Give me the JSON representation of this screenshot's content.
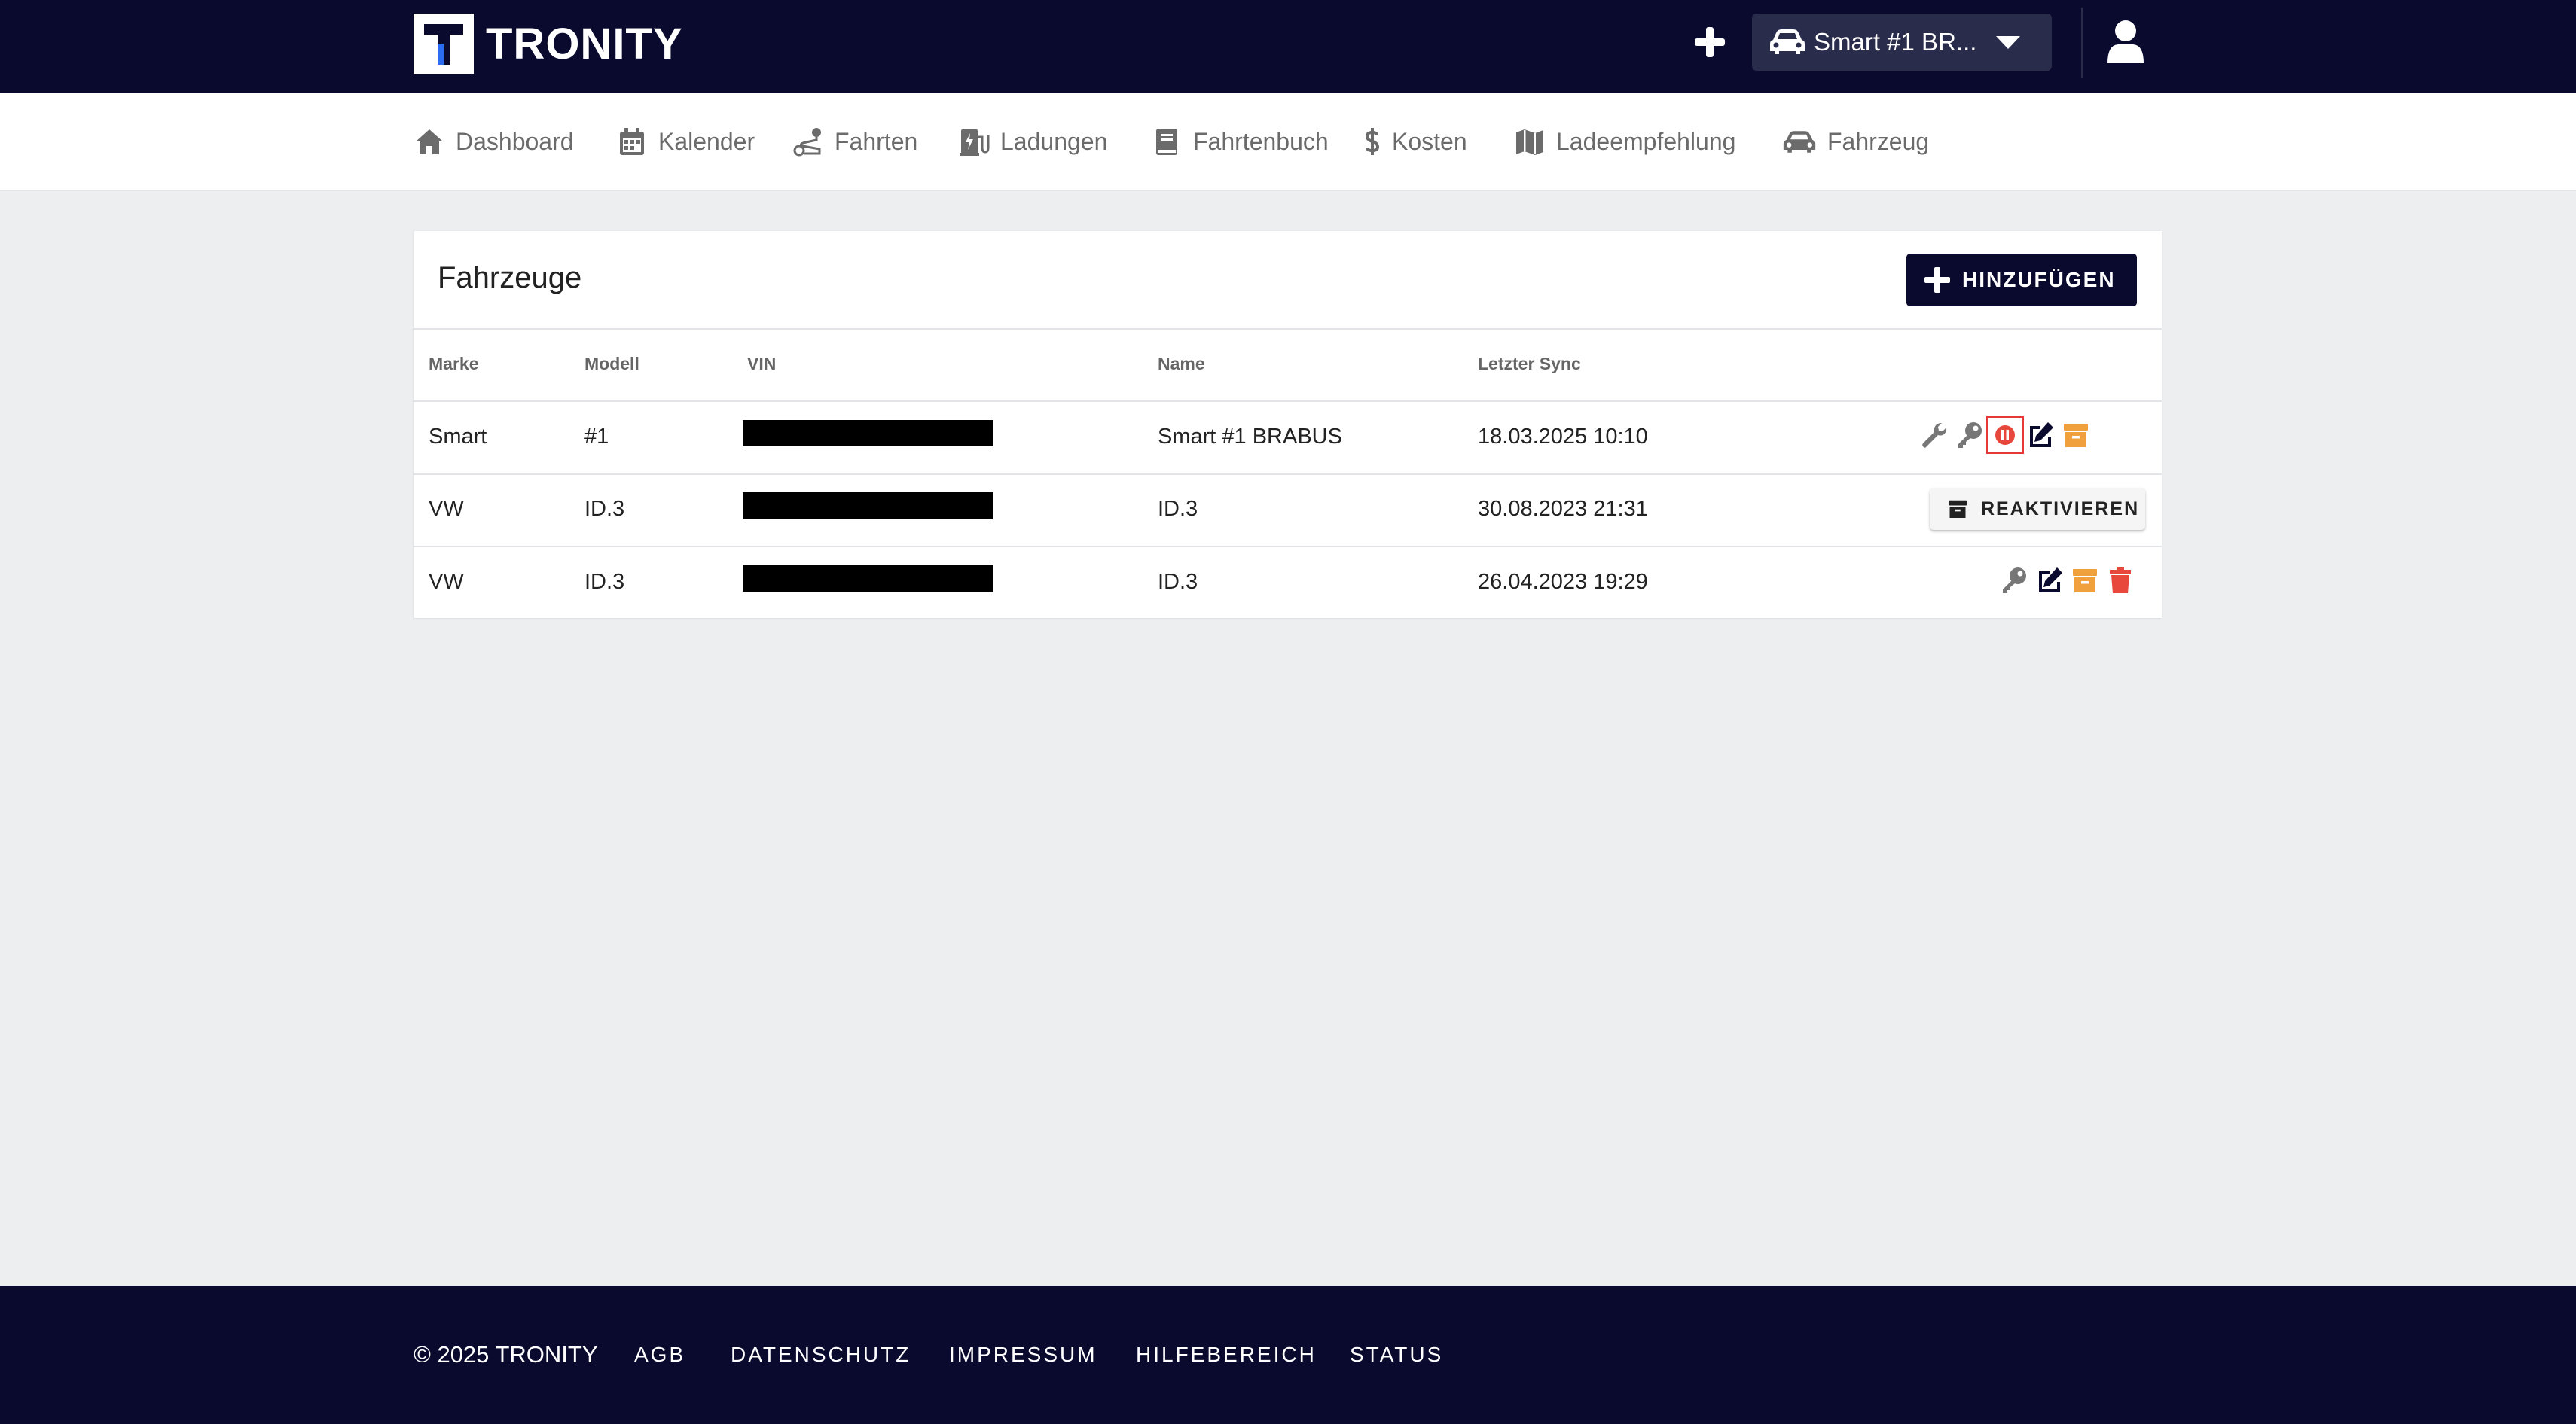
{
  "brand": {
    "name": "TRONITY"
  },
  "topbar": {
    "vehicle_select_label": "Smart #1 BR...",
    "icons": [
      "plus-icon",
      "car-icon",
      "chevron-down-icon",
      "user-icon"
    ]
  },
  "nav": {
    "items": [
      {
        "label": "Dashboard",
        "icon": "home-icon"
      },
      {
        "label": "Kalender",
        "icon": "calendar-icon"
      },
      {
        "label": "Fahrten",
        "icon": "route-icon"
      },
      {
        "label": "Ladungen",
        "icon": "charging-station-icon"
      },
      {
        "label": "Fahrtenbuch",
        "icon": "book-icon"
      },
      {
        "label": "Kosten",
        "icon": "dollar-icon"
      },
      {
        "label": "Ladeempfehlung",
        "icon": "map-icon"
      },
      {
        "label": "Fahrzeug",
        "icon": "car-icon"
      }
    ]
  },
  "vehicles": {
    "title": "Fahrzeuge",
    "add_label": "HINZUFÜGEN",
    "columns": {
      "make": "Marke",
      "model": "Modell",
      "vin": "VIN",
      "name": "Name",
      "last_sync": "Letzter Sync"
    },
    "rows": [
      {
        "make": "Smart",
        "model": "#1",
        "name": "Smart #1 BRABUS",
        "last_sync": "18.03.2025 10:10"
      },
      {
        "make": "VW",
        "model": "ID.3",
        "name": "ID.3",
        "last_sync": "30.08.2023 21:31",
        "reactivate_label": "REAKTIVIEREN"
      },
      {
        "make": "VW",
        "model": "ID.3",
        "name": "ID.3",
        "last_sync": "26.04.2023 19:29"
      }
    ]
  },
  "colors": {
    "navy": "#0a0a2e",
    "accent_blue": "#2b6cf0",
    "archive_orange": "#f0a03c",
    "delete_red": "#e8483c",
    "highlight_red": "#e53935"
  },
  "footer": {
    "copyright": "© 2025 TRONITY",
    "links": [
      "AGB",
      "DATENSCHUTZ",
      "IMPRESSUM",
      "HILFEBEREICH",
      "STATUS"
    ]
  }
}
